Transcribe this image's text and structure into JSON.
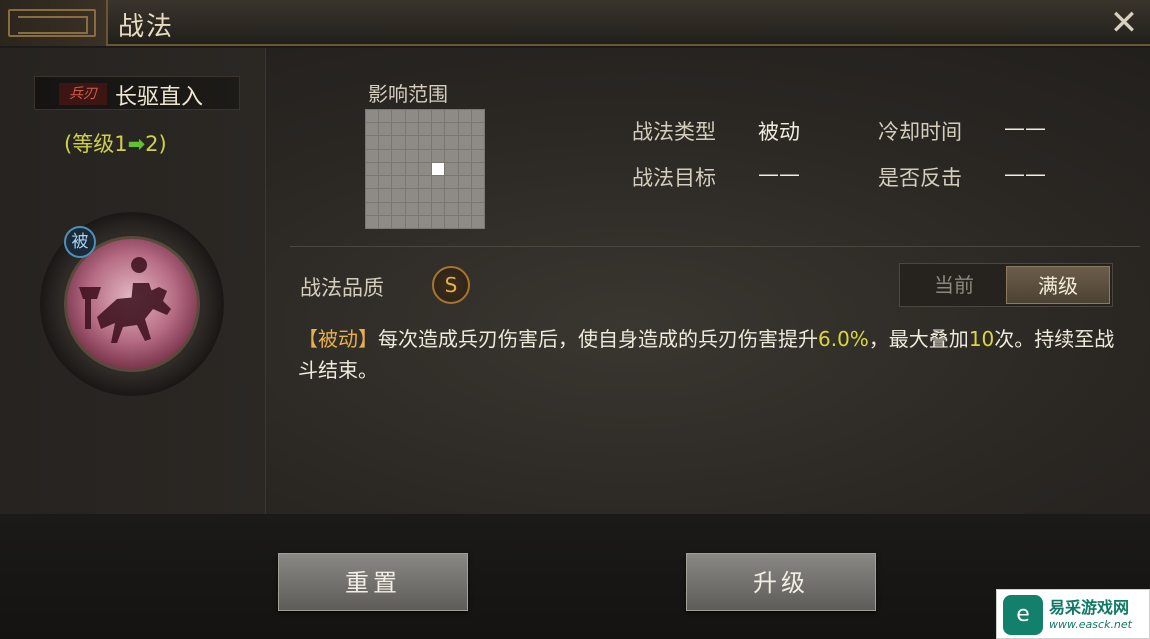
{
  "header": {
    "title": "战法",
    "close_icon": "close-icon"
  },
  "skill": {
    "weapon_tag": "兵刃",
    "name": "长驱直入",
    "level_prefix": "(等级1",
    "level_arrow": "➡",
    "level_suffix": "2)",
    "passive_badge": "被"
  },
  "range": {
    "label": "影响范围",
    "grid_size": 9,
    "highlighted_cell": [
      4,
      5
    ]
  },
  "info": {
    "type_label": "战法类型",
    "type_value": "被动",
    "cooldown_label": "冷却时间",
    "cooldown_value": "——",
    "target_label": "战法目标",
    "target_value": "——",
    "counter_label": "是否反击",
    "counter_value": "——"
  },
  "quality": {
    "label": "战法品质",
    "grade": "S"
  },
  "toggle": {
    "current": "当前",
    "max": "满级",
    "selected": "max"
  },
  "description": {
    "tag": "【被动】",
    "part1": "每次造成兵刃伤害后，使自身造成的兵刃伤害提升",
    "highlight1": "6.0%",
    "part2": "，最大叠加",
    "highlight2": "10",
    "part3": "次。持续至战斗结束。"
  },
  "buttons": {
    "reset": "重置",
    "upgrade": "升级"
  },
  "watermark": {
    "name": "易采游戏网",
    "url": "www.easck.net"
  },
  "colors": {
    "accent_gold": "#e8b04a",
    "level_green": "#63c033",
    "highlight_yellow": "#d9d73e"
  }
}
